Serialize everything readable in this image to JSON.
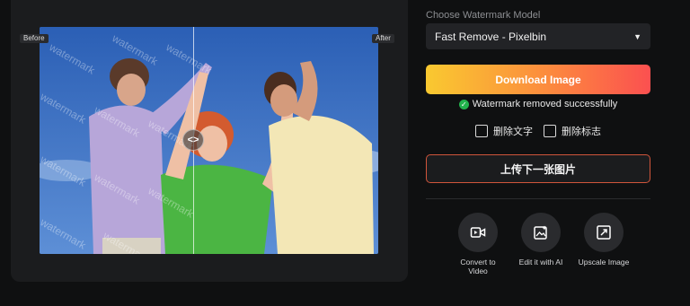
{
  "preview": {
    "before_label": "Before",
    "after_label": "After",
    "watermark_text": "watermark",
    "handle_icon": "code-brackets-icon"
  },
  "model": {
    "label": "Choose Watermark Model",
    "selected": "Fast Remove - Pixelbin",
    "caret_icon": "triangle-down-icon"
  },
  "actions": {
    "download_label": "Download Image",
    "download_gradient": [
      "#f9c930",
      "#fc8a3e",
      "#fb5050"
    ],
    "status_text": "Watermark removed successfully",
    "status_color": "#22b24c",
    "options": [
      {
        "label": "删除文字",
        "checked": false
      },
      {
        "label": "删除标志",
        "checked": false
      }
    ],
    "upload_label": "上传下一张图片",
    "upload_border_color": "#d0553b"
  },
  "tools": [
    {
      "label": "Convert to Video",
      "icon": "video-convert-icon"
    },
    {
      "label": "Edit it with AI",
      "icon": "ai-edit-icon"
    },
    {
      "label": "Upscale Image",
      "icon": "upscale-icon"
    }
  ]
}
